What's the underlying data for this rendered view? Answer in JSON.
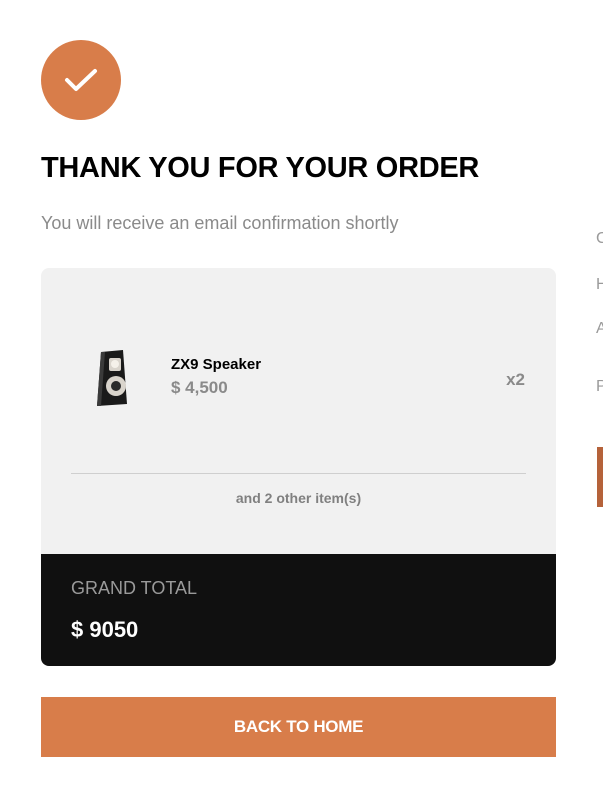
{
  "modal": {
    "title": "THANK YOU FOR YOUR ORDER",
    "subtitle": "You will receive an email confirmation shortly"
  },
  "order": {
    "item": {
      "name": "ZX9 Speaker",
      "price": "$ 4,500",
      "quantity": "x2"
    },
    "other_items_text": "and 2 other item(s)",
    "grand_total_label": "GRAND TOTAL",
    "grand_total_value": "$ 9050"
  },
  "actions": {
    "back_home_label": "BACK TO HOME"
  },
  "background_page": {
    "glyphs": [
      "C",
      "H",
      "A",
      "P"
    ]
  },
  "colors": {
    "accent": "#d87d4a",
    "dark": "#101010",
    "light_gray": "#f1f1f1",
    "muted_text": "#8a8a8a"
  }
}
